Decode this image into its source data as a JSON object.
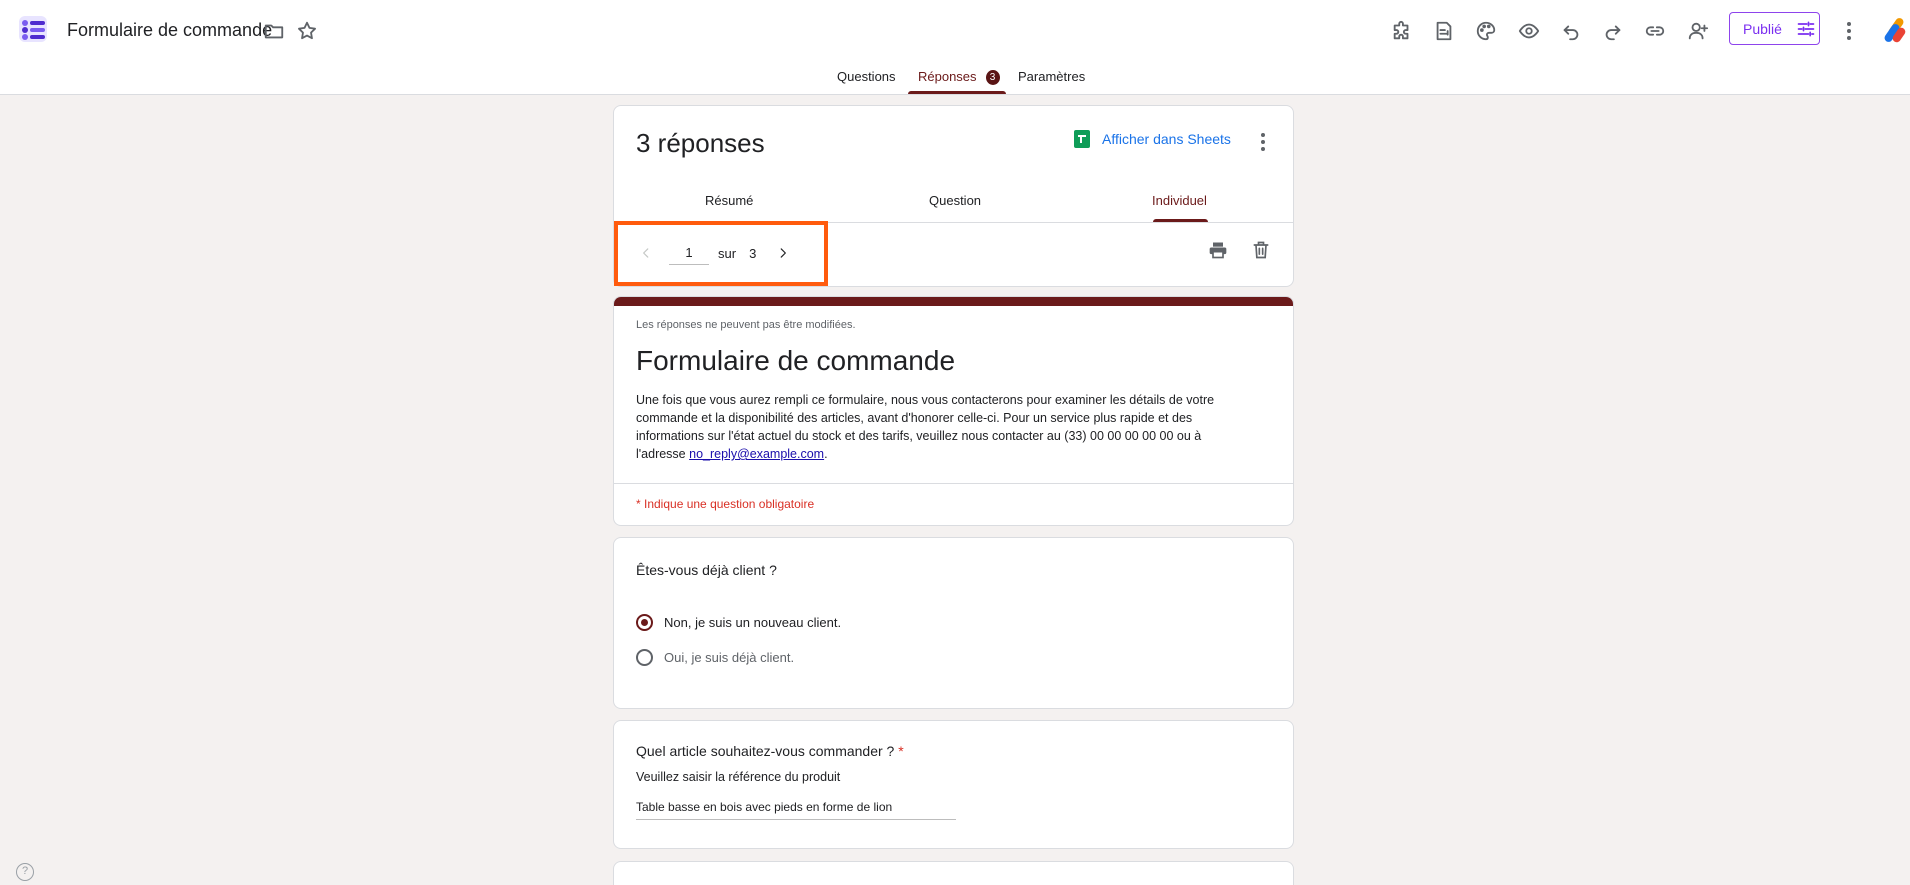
{
  "header": {
    "doc_title": "Formulaire de commande",
    "publish_label": "Publié"
  },
  "main_tabs": [
    {
      "label": "Questions"
    },
    {
      "label": "Réponses",
      "badge": "3"
    },
    {
      "label": "Paramètres"
    }
  ],
  "responses": {
    "count_label": "3 réponses",
    "sheets_link": "Afficher dans Sheets",
    "sub_tabs": [
      {
        "label": "Résumé"
      },
      {
        "label": "Question"
      },
      {
        "label": "Individuel"
      }
    ],
    "pager": {
      "current": "1",
      "of_label": "sur",
      "total": "3"
    }
  },
  "form": {
    "notice": "Les réponses ne peuvent pas être modifiées.",
    "title": "Formulaire de commande",
    "description": "Une fois que vous aurez rempli ce formulaire, nous vous contacterons pour examiner les détails de votre commande et la disponibilité des articles, avant d'honorer celle-ci. Pour un service plus rapide et des informations sur l'état actuel du stock et des tarifs, veuillez nous contacter au (33) 00 00 00 00 00 ou à l'adresse",
    "email": "no_reply@example.com",
    "required_note": "* Indique une question obligatoire"
  },
  "questions": [
    {
      "title": "Êtes-vous déjà client ?",
      "options": [
        {
          "label": "Non, je suis un nouveau client.",
          "selected": true
        },
        {
          "label": "Oui, je suis déjà client.",
          "selected": false
        }
      ]
    },
    {
      "title": "Quel article souhaitez-vous commander ?",
      "required_mark": "*",
      "subtitle": "Veuillez saisir la référence du produit",
      "answer": "Table basse en bois avec pieds en forme de lion"
    }
  ],
  "colors": {
    "accent": "#6b1a1a",
    "highlight": "#ff5b0d",
    "publish": "#7b2ff0",
    "link": "#1a73e8"
  },
  "icons": [
    "forms-logo-icon",
    "folder-icon",
    "star-icon",
    "addon-icon",
    "template-icon",
    "palette-icon",
    "preview-icon",
    "undo-icon",
    "redo-icon",
    "link-icon",
    "add-collaborator-icon",
    "tune-icon",
    "more-vert-icon",
    "sheets-icon",
    "chevron-left-icon",
    "chevron-right-icon",
    "print-icon",
    "trash-icon",
    "help-icon"
  ]
}
